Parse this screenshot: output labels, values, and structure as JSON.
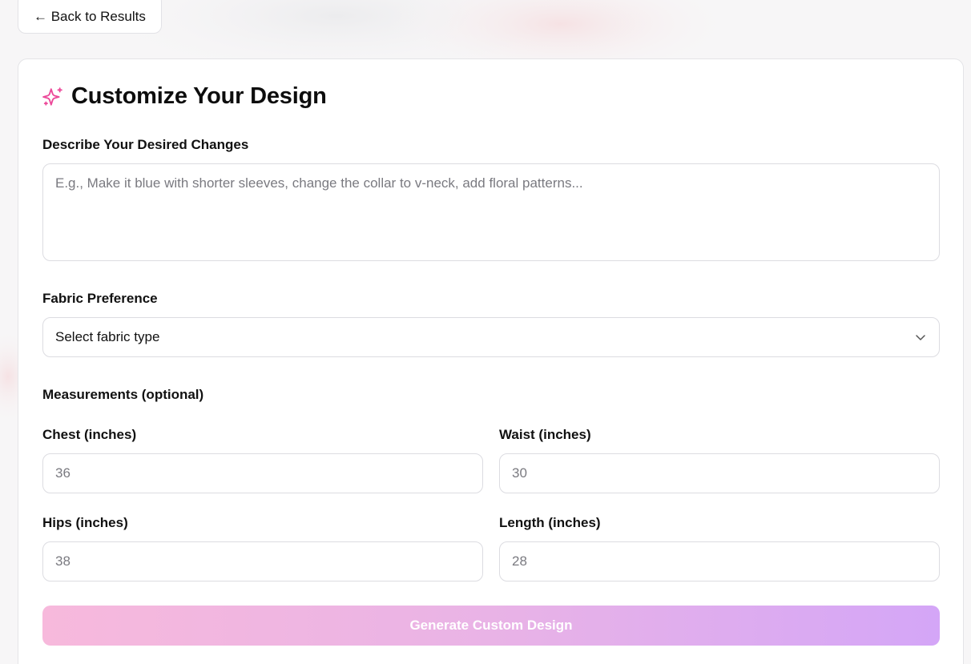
{
  "nav": {
    "back_label": "← Back to Results"
  },
  "form": {
    "title": "Customize Your Design",
    "title_icon": "sparkles-icon",
    "description": {
      "label": "Describe Your Desired Changes",
      "placeholder": "E.g., Make it blue with shorter sleeves, change the collar to v-neck, add floral patterns...",
      "value": ""
    },
    "fabric": {
      "label": "Fabric Preference",
      "selected": "Select fabric type",
      "icon": "chevron-down-icon"
    },
    "measurements": {
      "heading": "Measurements (optional)",
      "chest": {
        "label": "Chest (inches)",
        "placeholder": "36"
      },
      "waist": {
        "label": "Waist (inches)",
        "placeholder": "30"
      },
      "hips": {
        "label": "Hips (inches)",
        "placeholder": "38"
      },
      "length": {
        "label": "Length (inches)",
        "placeholder": "28"
      }
    },
    "submit_label": "Generate Custom Design"
  },
  "colors": {
    "accent": "#ec4899",
    "button_gradient_start": "#f7b9dc",
    "button_gradient_end": "#d4a6f7"
  }
}
